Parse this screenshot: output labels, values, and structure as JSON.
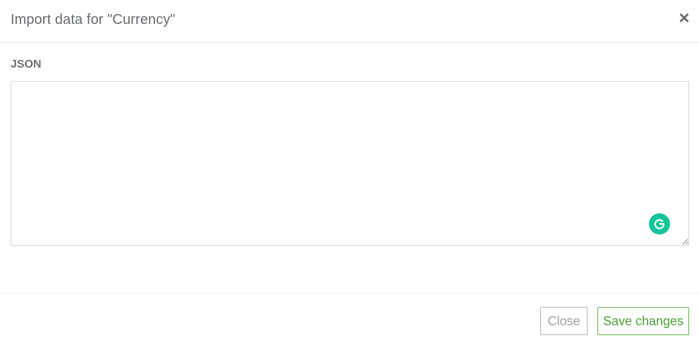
{
  "dialog": {
    "title": "Import data for \"Currency\"",
    "close_glyph": "×"
  },
  "form": {
    "json_label": "JSON",
    "json_value": "",
    "json_placeholder": ""
  },
  "extension": {
    "icon": "grammarly-icon",
    "color": "#15c39a"
  },
  "footer": {
    "close_label": "Close",
    "save_label": "Save changes"
  },
  "colors": {
    "save_accent": "#4d9f37",
    "title_text": "#666a6e"
  }
}
